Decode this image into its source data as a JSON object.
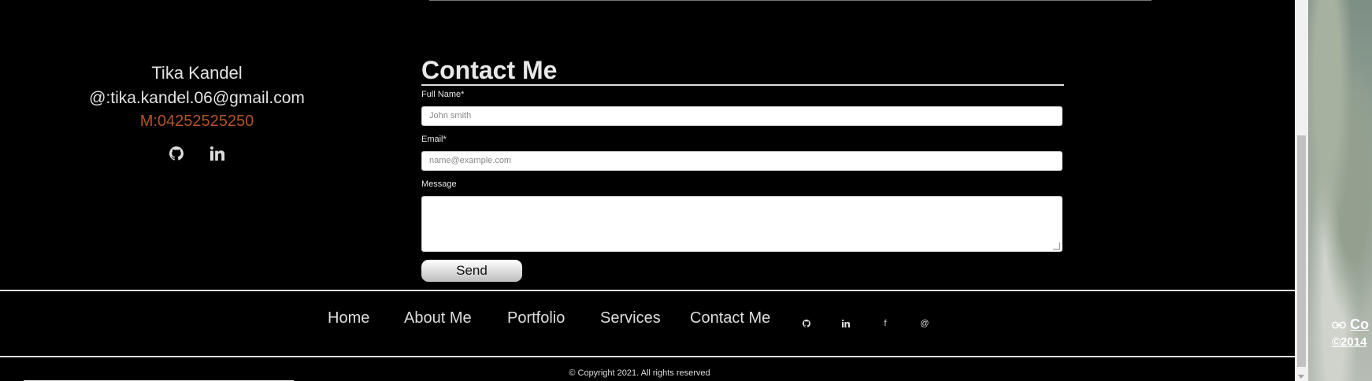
{
  "profile": {
    "name": "Tika Kandel",
    "email": "@:tika.kandel.06@gmail.com",
    "phone": "M:04252525250"
  },
  "contact_form": {
    "title": "Contact Me",
    "full_name_label": "Full Name*",
    "full_name_placeholder": "John smith",
    "email_label": "Email*",
    "email_placeholder": "name@example.com",
    "message_label": "Message",
    "send_label": "Send"
  },
  "footer": {
    "nav": [
      "Home",
      "About Me",
      "Portfolio",
      "Services",
      "Contact Me"
    ],
    "at_icon": "@",
    "facebook_icon": "f",
    "copyright": "© Copyright 2021. All rights reserved"
  },
  "background_overlay": {
    "link_text": "Co",
    "copyright_text": "©2014"
  },
  "icons": [
    "github-icon",
    "linkedin-icon",
    "facebook-icon",
    "at-icon",
    "link-icon"
  ]
}
